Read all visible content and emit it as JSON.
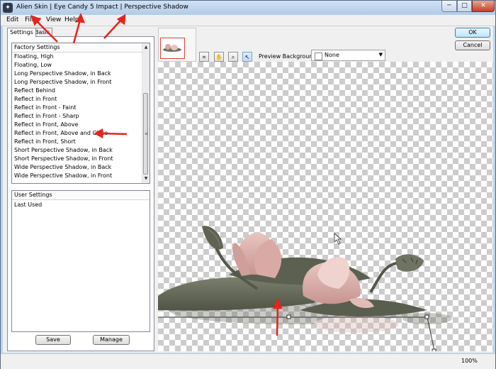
{
  "window": {
    "title": "Alien Skin | Eye Candy 5 Impact | Perspective Shadow",
    "app_icon": "alien-skin-icon",
    "controls": [
      "minimize-icon",
      "maximize-icon",
      "close-icon"
    ]
  },
  "menu": [
    "Edit",
    "Filter",
    "View",
    "Help"
  ],
  "tabs": [
    "Settings",
    "Basic"
  ],
  "factory_settings": {
    "header": "Factory Settings",
    "items": [
      "Floating, High",
      "Floating, Low",
      "Long Perspective Shadow, in Back",
      "Long Perspective Shadow, in Front",
      "Reflect Behind",
      "Reflect in Front",
      "Reflect in Front - Faint",
      "Reflect in Front - Sharp",
      "Reflect in Front, Above",
      "Reflect in Front, Above and Close",
      "Reflect in Front, Short",
      "Short Perspective Shadow, in Back",
      "Short Perspective Shadow, in Front",
      "Wide Perspective Shadow, in Back",
      "Wide Perspective Shadow, in Front"
    ]
  },
  "user_settings": {
    "header": "User Settings",
    "items": [
      "Last Used"
    ]
  },
  "buttons": {
    "save": "Save",
    "manage": "Manage",
    "ok": "OK",
    "cancel": "Cancel"
  },
  "toolbar": {
    "tools": [
      "navigator-icon",
      "hand-tool-icon",
      "zoom-tool-icon",
      "pointer-tool-icon"
    ],
    "preview_background_label": "Preview Background:",
    "preview_background_value": "None"
  },
  "status": {
    "zoom": "100%"
  },
  "colors": {
    "annotation_arrow": "#e8231c",
    "title_bar": "#c3d7ef",
    "checker": "#cccccc"
  }
}
